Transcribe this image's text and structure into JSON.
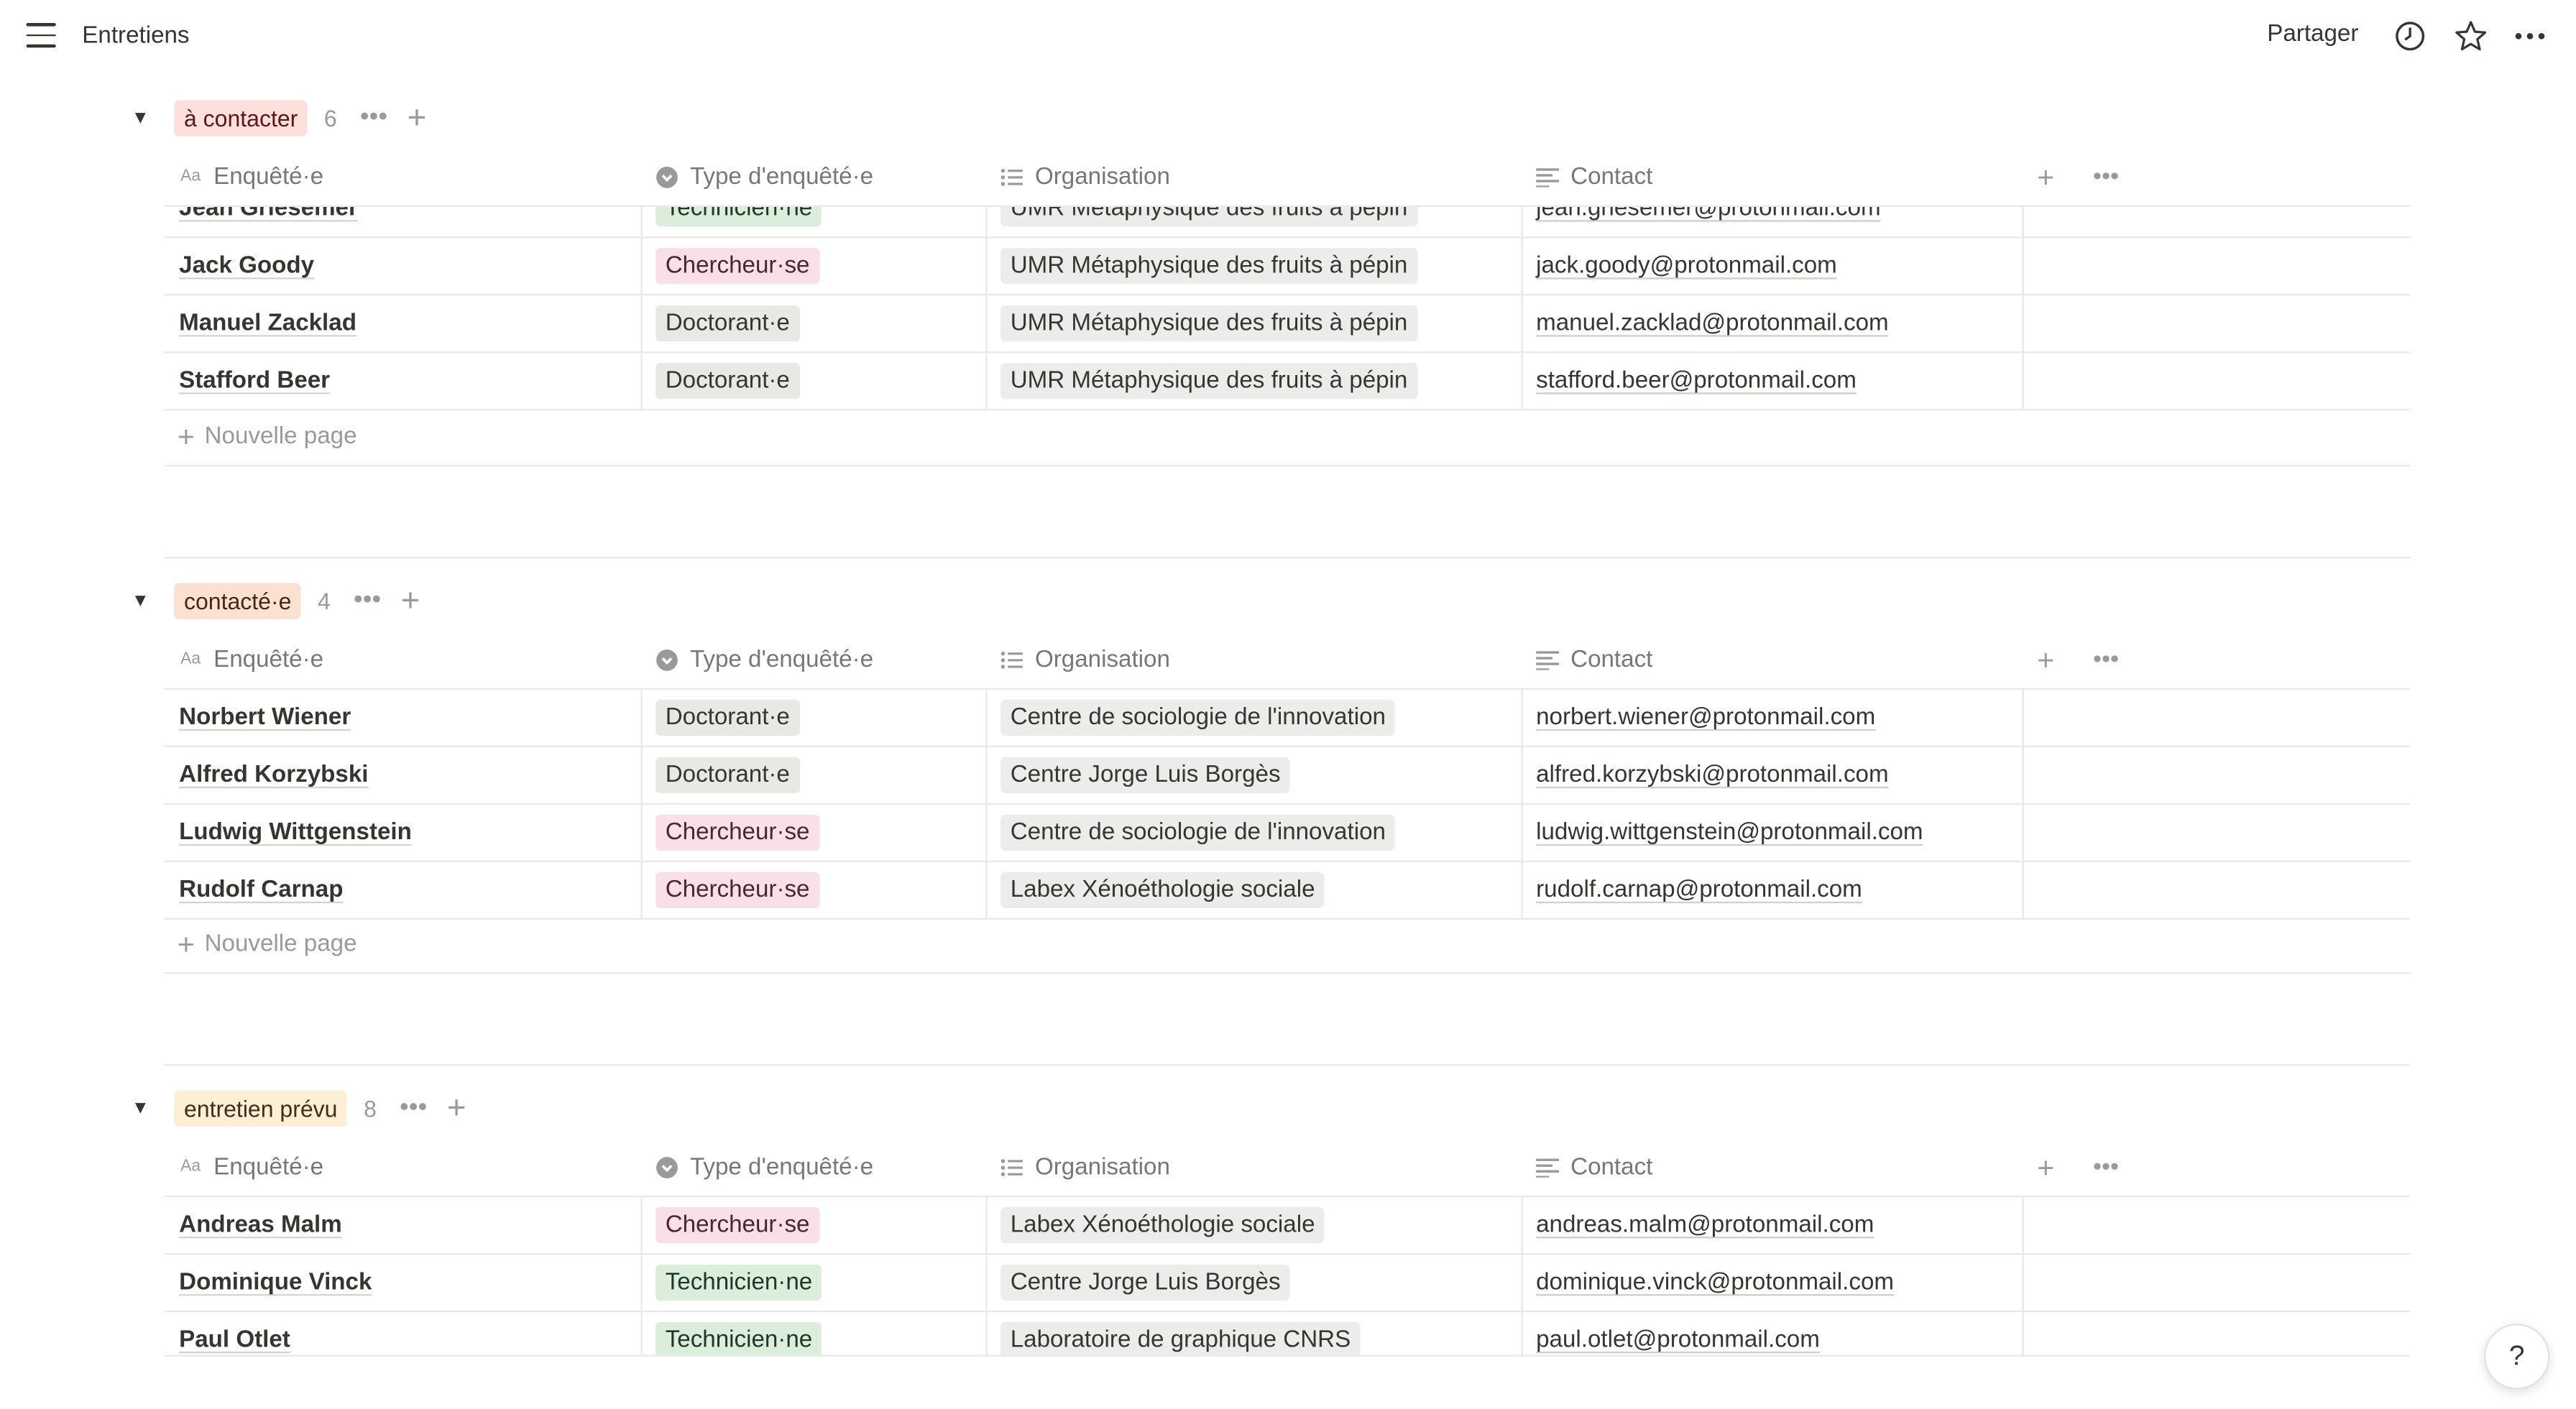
{
  "header": {
    "title": "Entretiens",
    "share_label": "Partager",
    "icons": [
      "menu-icon",
      "clock-icon",
      "star-icon",
      "more-icon"
    ]
  },
  "columns": {
    "name": "Enquêté·e",
    "type": "Type d'enquêté·e",
    "org": "Organisation",
    "contact": "Contact",
    "name_icon": "Aa"
  },
  "new_page_label": "Nouvelle page",
  "colors": {
    "tag_a_contacter": "#fde0dc",
    "tag_contacte": "#fbe1d1",
    "tag_entretien_prevu": "#fcefd4",
    "pill_technicien": "#dbeddb",
    "pill_chercheur": "#f9dfe6",
    "pill_doctorant": "#e9e8e5",
    "pill_org": "#ececea"
  },
  "groups": [
    {
      "label": "à contacter",
      "count": "6",
      "rows": [
        {
          "name": "Jean Griesemer",
          "type": "Technicien·ne",
          "org": "UMR Métaphysique des fruits à pépin",
          "contact": "jean.griesemer@protonmail.com"
        },
        {
          "name": "Jack Goody",
          "type": "Chercheur·se",
          "org": "UMR Métaphysique des fruits à pépin",
          "contact": "jack.goody@protonmail.com"
        },
        {
          "name": "Manuel Zacklad",
          "type": "Doctorant·e",
          "org": "UMR Métaphysique des fruits à pépin",
          "contact": "manuel.zacklad@protonmail.com"
        },
        {
          "name": "Stafford Beer",
          "type": "Doctorant·e",
          "org": "UMR Métaphysique des fruits à pépin",
          "contact": "stafford.beer@protonmail.com"
        }
      ]
    },
    {
      "label": "contacté·e",
      "count": "4",
      "rows": [
        {
          "name": "Norbert Wiener",
          "type": "Doctorant·e",
          "org": "Centre de sociologie de l'innovation",
          "contact": "norbert.wiener@protonmail.com"
        },
        {
          "name": "Alfred Korzybski",
          "type": "Doctorant·e",
          "org": "Centre Jorge Luis Borgès",
          "contact": "alfred.korzybski@protonmail.com"
        },
        {
          "name": "Ludwig Wittgenstein",
          "type": "Chercheur·se",
          "org": "Centre de sociologie de l'innovation",
          "contact": "ludwig.wittgenstein@protonmail.com"
        },
        {
          "name": "Rudolf Carnap",
          "type": "Chercheur·se",
          "org": "Labex Xénoéthologie sociale",
          "contact": "rudolf.carnap@protonmail.com"
        }
      ]
    },
    {
      "label": "entretien prévu",
      "count": "8",
      "rows": [
        {
          "name": "Andreas Malm",
          "type": "Chercheur·se",
          "org": "Labex Xénoéthologie sociale",
          "contact": "andreas.malm@protonmail.com"
        },
        {
          "name": "Dominique Vinck",
          "type": "Technicien·ne",
          "org": "Centre Jorge Luis Borgès",
          "contact": "dominique.vinck@protonmail.com"
        },
        {
          "name": "Paul Otlet",
          "type": "Technicien·ne",
          "org": "Laboratoire de graphique CNRS",
          "contact": "paul.otlet@protonmail.com"
        }
      ]
    }
  ],
  "help_label": "?"
}
